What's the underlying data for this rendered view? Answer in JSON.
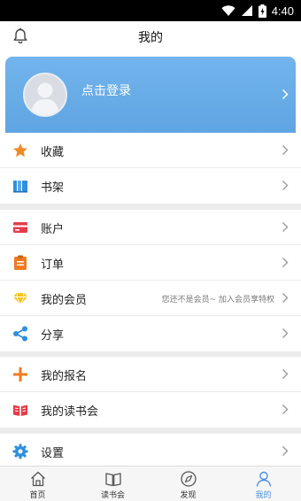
{
  "status_bar": {
    "time": "4:40",
    "icons": [
      "wifi-icon",
      "signal-icon",
      "battery-icon"
    ]
  },
  "header": {
    "title": "我的",
    "left_icon": "bell-icon"
  },
  "profile": {
    "login_text": "点击登录",
    "avatar_icon": "default-avatar-icon",
    "card_color": "#66aae6"
  },
  "menu_groups": [
    {
      "items": [
        {
          "label": "收藏",
          "icon": "star-icon",
          "color": "#f08a24"
        },
        {
          "label": "书架",
          "icon": "bookshelf-icon",
          "color": "#2f8fdd"
        }
      ]
    },
    {
      "items": [
        {
          "label": "账户",
          "icon": "card-icon",
          "color": "#e53c4b"
        },
        {
          "label": "订单",
          "icon": "clipboard-icon",
          "color": "#f07b22"
        },
        {
          "label": "我的会员",
          "icon": "diamond-icon",
          "color": "#f4c21c",
          "note": "您还不是会员~ 加入会员享特权"
        },
        {
          "label": "分享",
          "icon": "share-icon",
          "color": "#2f8fdd"
        }
      ]
    },
    {
      "items": [
        {
          "label": "我的报名",
          "icon": "plus-icon",
          "color": "#f07b22"
        },
        {
          "label": "我的读书会",
          "icon": "open-book-icon",
          "color": "#e53c4b"
        }
      ]
    },
    {
      "items": [
        {
          "label": "设置",
          "icon": "gear-icon",
          "color": "#2f8fdd"
        }
      ]
    }
  ],
  "tab_bar": [
    {
      "label": "首页",
      "icon": "home-icon",
      "active": false
    },
    {
      "label": "读书会",
      "icon": "book-icon",
      "active": false
    },
    {
      "label": "发现",
      "icon": "compass-icon",
      "active": false
    },
    {
      "label": "我的",
      "icon": "person-icon",
      "active": true
    }
  ],
  "accent_color": "#4a90e2"
}
